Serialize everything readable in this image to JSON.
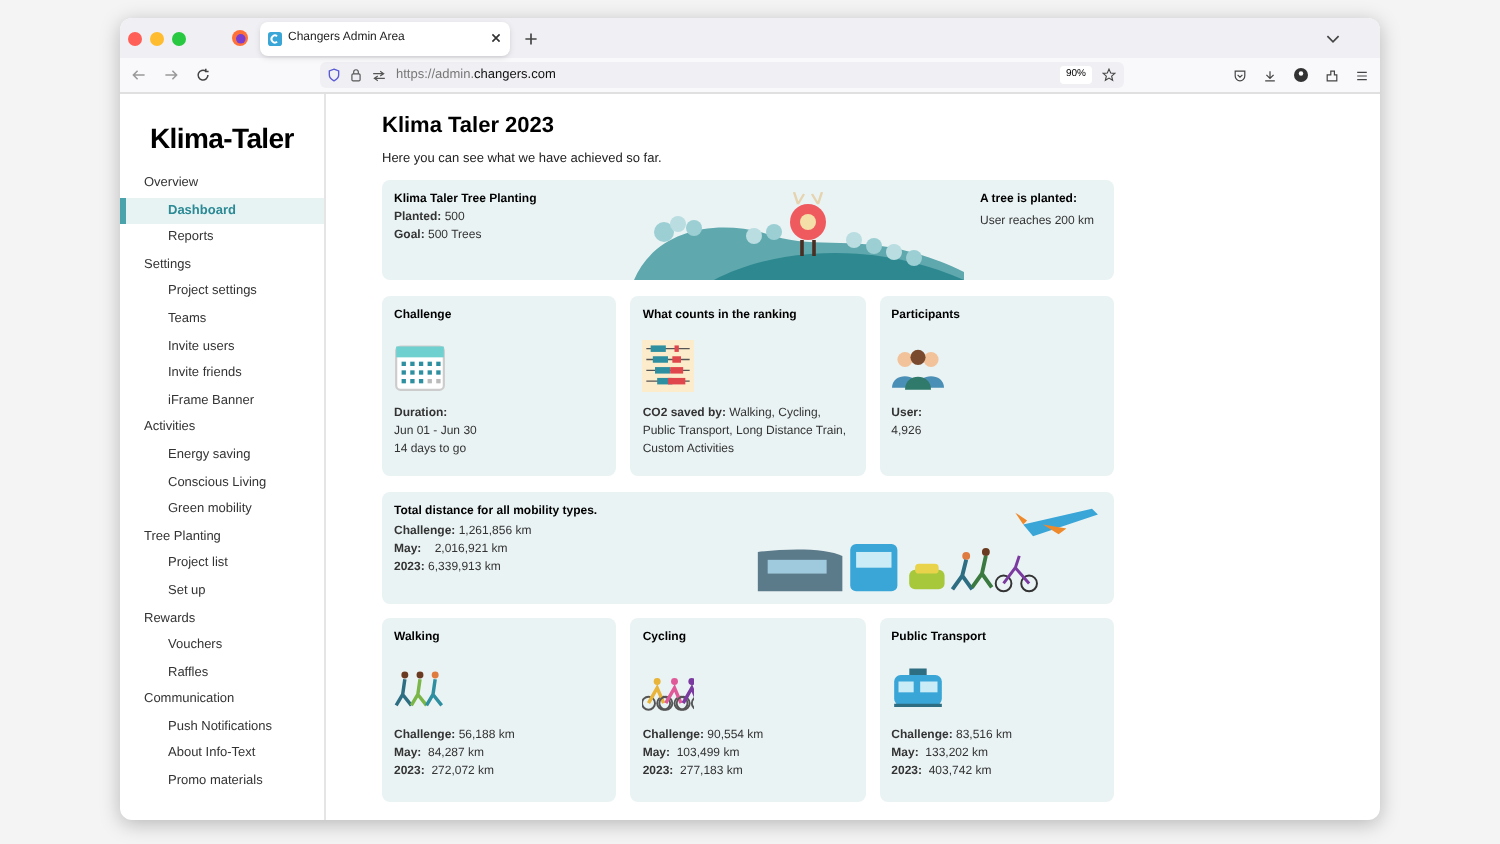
{
  "browser": {
    "tab_title": "Changers Admin Area",
    "url_scheme": "https://admin.",
    "url_domain": "changers.com",
    "zoom": "90%"
  },
  "sidebar": {
    "logo": "Klima-Taler",
    "sections": [
      {
        "label": "Overview",
        "items": [
          {
            "label": "Dashboard",
            "selected": true
          },
          {
            "label": "Reports",
            "selected": false
          }
        ]
      },
      {
        "label": "Settings",
        "items": [
          {
            "label": "Project settings",
            "selected": false
          },
          {
            "label": "Teams",
            "selected": false
          },
          {
            "label": "Invite users",
            "selected": false
          },
          {
            "label": "Invite friends",
            "selected": false
          },
          {
            "label": "iFrame Banner",
            "selected": false
          }
        ]
      },
      {
        "label": "Activities",
        "items": [
          {
            "label": "Energy saving",
            "selected": false
          },
          {
            "label": "Conscious Living",
            "selected": false
          },
          {
            "label": "Green mobility",
            "selected": false
          }
        ]
      },
      {
        "label": "Tree Planting",
        "items": [
          {
            "label": "Project list",
            "selected": false
          },
          {
            "label": "Set up",
            "selected": false
          }
        ]
      },
      {
        "label": "Rewards",
        "items": [
          {
            "label": "Vouchers",
            "selected": false
          },
          {
            "label": "Raffles",
            "selected": false
          }
        ]
      },
      {
        "label": "Communication",
        "items": [
          {
            "label": "Push Notifications",
            "selected": false
          },
          {
            "label": "About Info-Text",
            "selected": false
          },
          {
            "label": "Promo materials",
            "selected": false
          }
        ]
      }
    ]
  },
  "page": {
    "title": "Klima Taler 2023",
    "subtitle": "Here you can see what we have achieved so far."
  },
  "tree_banner": {
    "title": "Klima Taler Tree Planting",
    "lines": [
      "**Planted:** 500",
      "**Goal:** 500 Trees"
    ],
    "right_title": "A tree is planted:",
    "right_text": "User reaches 200 km"
  },
  "info_cards": [
    {
      "kind": "calendar",
      "title": "Challenge",
      "lines": [
        "**Duration:**",
        "Jun 01 - Jun 30",
        "14 days to go"
      ]
    },
    {
      "kind": "abacus",
      "title": "What counts in the ranking",
      "lines": [
        "**CO2 saved by:** Walking, Cycling, Public Transport, Long Distance Train, Custom Activities"
      ]
    },
    {
      "kind": "people",
      "title": "Participants",
      "lines": [
        "**User:**",
        "4,926"
      ]
    }
  ],
  "total": {
    "title": "Total distance for all mobility types.",
    "lines": [
      "**Challenge:** 1,261,856 km",
      "**May:**    2,016,921 km",
      "**2023:** 6,339,913 km"
    ]
  },
  "mobility_cards": [
    {
      "kind": "walking",
      "title": "Walking",
      "lines": [
        "**Challenge:** 56,188 km",
        "**May:**  84,287 km",
        "**2023:**  272,072 km"
      ]
    },
    {
      "kind": "cycling",
      "title": "Cycling",
      "lines": [
        "**Challenge:** 90,554 km",
        "**May:**  103,499 km",
        "**2023:**  277,183 km"
      ]
    },
    {
      "kind": "transit",
      "title": "Public Transport",
      "lines": [
        "**Challenge:** 83,516 km",
        "**May:**  133,202 km",
        "**2023:**  403,742 km"
      ]
    }
  ]
}
